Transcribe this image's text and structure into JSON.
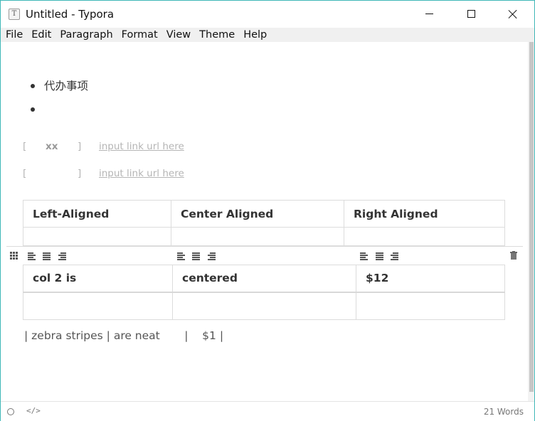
{
  "window": {
    "title": "Untitled - Typora",
    "app_icon_glyph": "T",
    "border_color": "#3fb7b7"
  },
  "menu": {
    "items": [
      "File",
      "Edit",
      "Paragraph",
      "Format",
      "View",
      "Theme",
      "Help"
    ]
  },
  "editor": {
    "bullets": [
      "代办事项",
      ""
    ],
    "link_rows": [
      {
        "open": "[",
        "text": "xx",
        "close": "]",
        "url_placeholder": "input link url here"
      },
      {
        "open": "[",
        "text": "",
        "close": "]",
        "url_placeholder": "input link url here"
      }
    ],
    "table1": {
      "headers": [
        "Left-Aligned",
        "Center Aligned",
        "Right Aligned"
      ],
      "rows": [
        [
          "",
          "",
          ""
        ]
      ]
    },
    "table_toolbar": {
      "icons": [
        "grid-icon",
        "align-left-icon",
        "align-center-icon",
        "align-right-icon",
        "trash-icon"
      ]
    },
    "table2": {
      "rows": [
        [
          "col 2 is",
          "centered",
          "$12"
        ],
        [
          "",
          "",
          ""
        ]
      ]
    },
    "raw_line": "| zebra stripes | are neat       |    $1 |"
  },
  "status": {
    "circle_icon": "outline-icon",
    "code_icon_glyph": "</>",
    "word_count": "21 Words"
  }
}
